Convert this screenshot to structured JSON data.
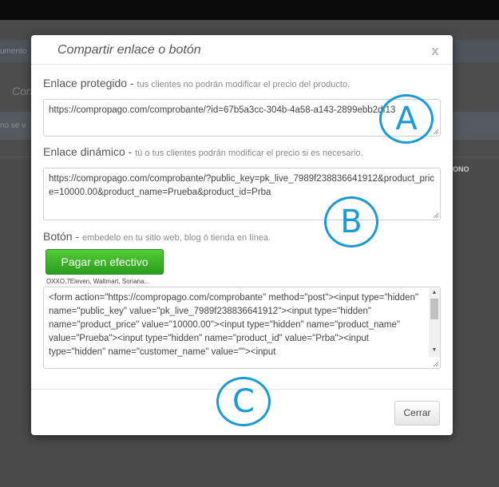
{
  "background": {
    "strip1_text": "umento",
    "panel_title": "Con",
    "strip2_text": "no se v",
    "column_header": "ONO"
  },
  "modal": {
    "title": "Compartir enlace o botón",
    "close_symbol": "x",
    "protected_link": {
      "label": "Enlace protegido",
      "separator": " - ",
      "hint": "tus clientes no podrán modificar el precio del producto.",
      "value": "https://compropago.com/comprobante/?id=67b5a3cc-304b-4a58-a143-2899ebb2df13"
    },
    "dynamic_link": {
      "label": "Enlace dinámico",
      "separator": " - ",
      "hint": "tú o tus clientes podrán modificar el precio si es necesario.",
      "value": "https://compropago.com/comprobante/?public_key=pk_live_7989f238836641912&product_price=10000.00&product_name=Prueba&product_id=Prba"
    },
    "button_section": {
      "label": "Botón",
      "separator": " - ",
      "hint": "embedelo en tu sitio web, blog ó tienda en línea.",
      "pay_button_label": "Pagar en efectivo",
      "stores_text": "OXXO,7Eleven, Waltmart, Soriana...",
      "embed_code": "<form action=\"https://compropago.com/comprobante\" method=\"post\"><input type=\"hidden\" name=\"public_key\" value=\"pk_live_7989f238836641912\"><input type=\"hidden\" name=\"product_price\" value=\"10000.00\"><input type=\"hidden\" name=\"product_name\" value=\"Prueba\"><input type=\"hidden\" name=\"product_id\" value=\"Prba\"><input type=\"hidden\" name=\"customer_name\" value=\"\"><input"
    },
    "footer": {
      "close_button_label": "Cerrar"
    }
  },
  "annotations": {
    "marker_a": "A",
    "marker_b": "B",
    "marker_c": "C",
    "color": "#1a9ad6"
  },
  "colors": {
    "pay_button": "#3bb82a",
    "overlay": "#4a4a4a"
  }
}
